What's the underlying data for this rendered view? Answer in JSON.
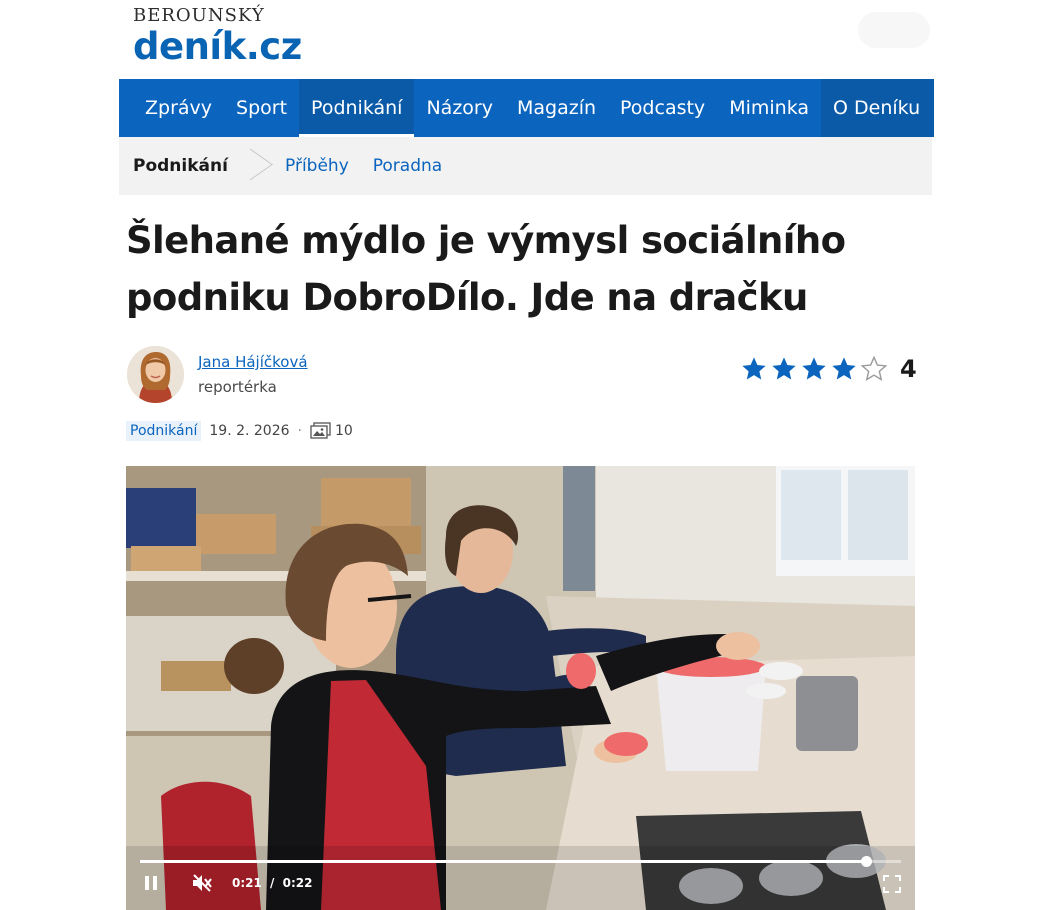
{
  "logo": {
    "top": "BEROUNSKÝ",
    "main": "deník.cz"
  },
  "nav": {
    "items": [
      {
        "label": "Zprávy"
      },
      {
        "label": "Sport"
      },
      {
        "label": "Podnikání"
      },
      {
        "label": "Názory"
      },
      {
        "label": "Magazín"
      },
      {
        "label": "Podcasty"
      },
      {
        "label": "Miminka"
      },
      {
        "label": "O Deníku"
      }
    ],
    "active": "Podnikání"
  },
  "subnav": {
    "current": "Podnikání",
    "links": [
      {
        "label": "Příběhy"
      },
      {
        "label": "Poradna"
      }
    ]
  },
  "article": {
    "headline_line1": "Šlehané mýdlo je výmysl sociálního",
    "headline_line2": "podniku DobroDílo. Jde na dračku",
    "author_name": "Jana Hájíčková",
    "author_role": "reportérka",
    "rating": {
      "value": "4",
      "filled": 4,
      "max": 5
    },
    "meta": {
      "category": "Podnikání",
      "date": "19. 2. 2026",
      "gallery_count": "10"
    }
  },
  "video": {
    "current_time": "0:21",
    "separator": "/",
    "duration": "0:22",
    "progress": 0.9545,
    "muted": true,
    "playing": true,
    "box_label": "DobroDílo"
  },
  "colors": {
    "brand": "#0b64bd",
    "nav_active": "#0a5aa8",
    "subnav_bg": "#f2f2f2",
    "star": "#0b64bd"
  },
  "icons": [
    "play-pause-icon",
    "muted-icon",
    "fullscreen-icon",
    "gallery-icon",
    "star-icon"
  ]
}
